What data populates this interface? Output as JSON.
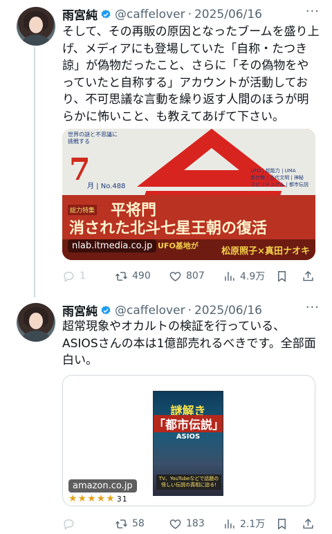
{
  "tweets": [
    {
      "name": "雨宮純",
      "handle": "@caffelover",
      "separator": "·",
      "date": "2025/06/16",
      "text": "そして、その再販の原因となったブームを盛り上げ、メディアにも登場していた「自称・たつき諒」が偽物だったこと、さらに「その偽物をやっていたと自称する」アカウントが活動しており、不可思議な言動を繰り返す人間のほうが明らかに怖いこと、も教えてあげて下さい。",
      "media": {
        "caption": "nlab.itmedia.co.jp",
        "magazine": {
          "sub": [
            "世界の謎と不思議に",
            "挑戦する"
          ],
          "issue_number": "7",
          "issue_label": "月 | No.488",
          "right_topics": [
            "UFO | 超能力 | UMA",
            "新宗教 | 古代文明 | 神秘",
            "スピリチュアル | 都市伝説"
          ],
          "tag": "総力特集",
          "headline_1": "平将門",
          "headline_2": "消された北斗七星王朝の復活",
          "band_1": "UFO基地が",
          "band_2": "松原照子×真田ナオキ"
        }
      },
      "stats": {
        "reply": "1",
        "retweet": "490",
        "like": "807",
        "views": "4.9万"
      }
    },
    {
      "name": "雨宮純",
      "handle": "@caffelover",
      "separator": "·",
      "date": "2025/06/16",
      "text": "超常現象やオカルトの検証を行っている、ASIOSさんの本は1億部売れるべきです。全部面白い。",
      "link_card": {
        "caption": "amazon.co.jp",
        "rating_stars": "★★★★★",
        "rating_value": 4.5,
        "rating_count": "31",
        "book": {
          "title_1": "謎解き",
          "title_2": "「都市伝説」",
          "author": "ASIOS",
          "footer": "TV、YouTubeなどで話題の怪しい伝説の真相に迫る!"
        }
      },
      "stats": {
        "reply": "",
        "retweet": "58",
        "like": "183",
        "views": "2.1万"
      }
    }
  ],
  "colors": {
    "verified": "#1d9bf0",
    "muted": "#536471",
    "text": "#0f1419",
    "divider": "#cfd9de"
  },
  "icons": [
    "verified-badge-icon",
    "more-icon",
    "reply-icon",
    "retweet-icon",
    "like-icon",
    "views-icon",
    "bookmark-icon",
    "share-icon"
  ]
}
